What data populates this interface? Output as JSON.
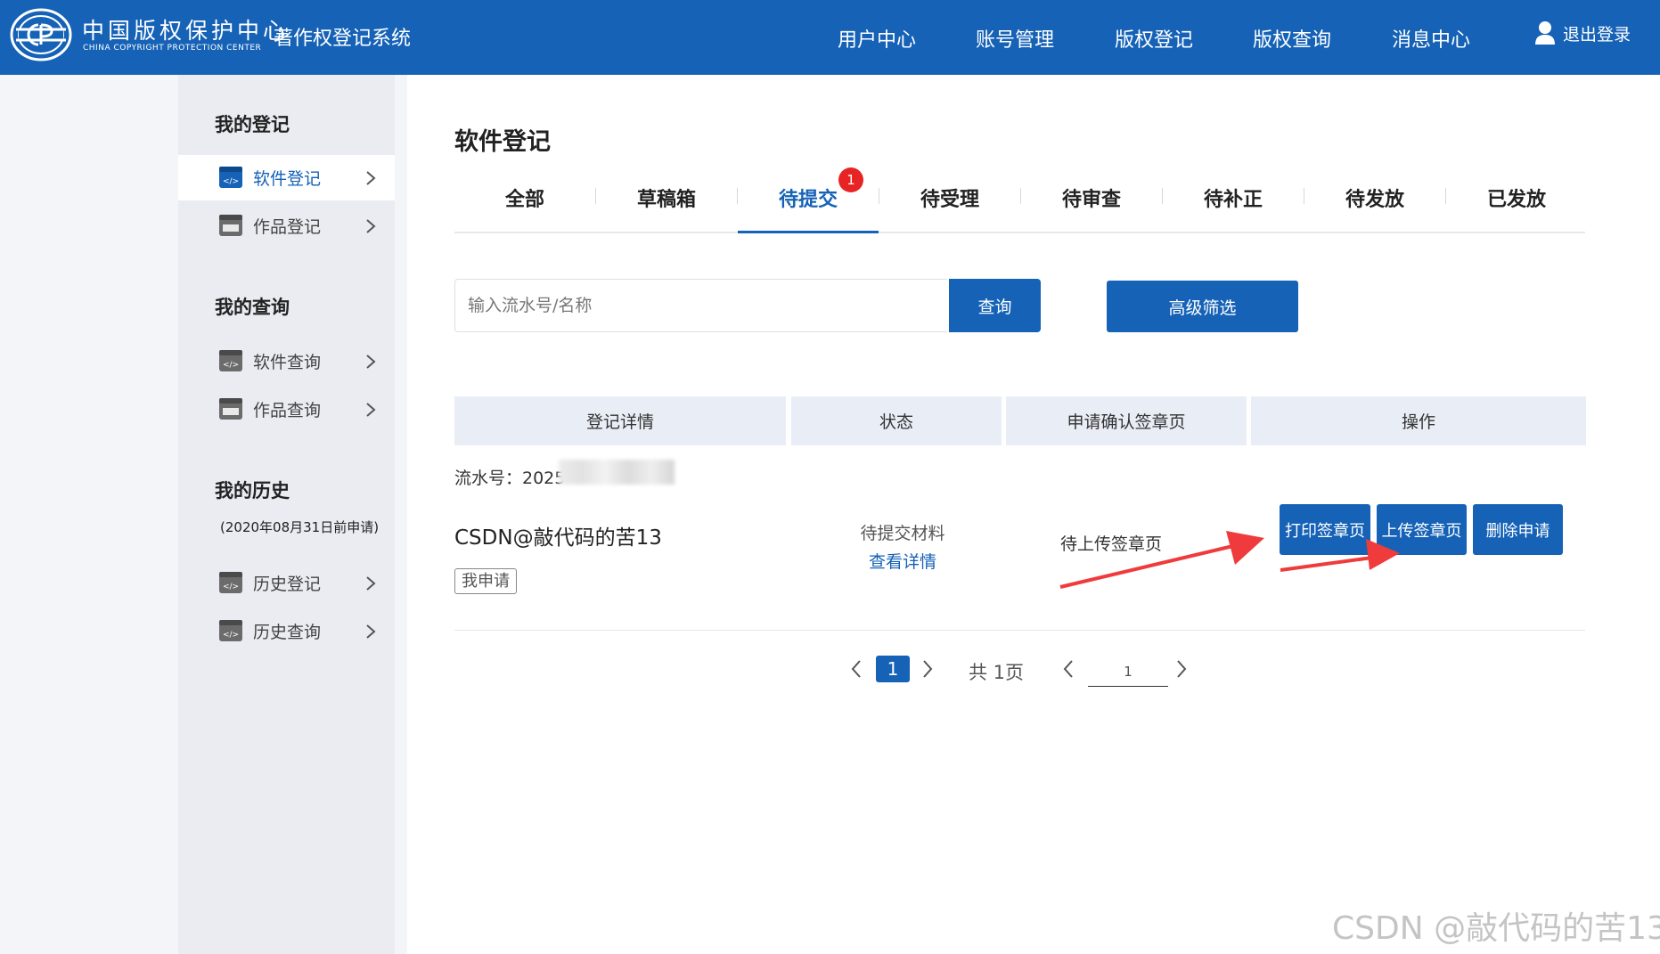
{
  "header": {
    "logo_cn": "中国版权保护中心",
    "logo_en": "CHINA COPYRIGHT PROTECTION CENTER",
    "system_title": "著作权登记系统",
    "nav": [
      "用户中心",
      "账号管理",
      "版权登记",
      "版权查询",
      "消息中心"
    ],
    "logout": "退出登录"
  },
  "sidebar": {
    "sections": [
      {
        "title": "我的登记",
        "items": [
          {
            "label": "软件登记",
            "active": true
          },
          {
            "label": "作品登记"
          }
        ]
      },
      {
        "title": "我的查询",
        "items": [
          {
            "label": "软件查询"
          },
          {
            "label": "作品查询"
          }
        ]
      },
      {
        "title": "我的历史",
        "subtitle": "(2020年08月31日前申请)",
        "items": [
          {
            "label": "历史登记"
          },
          {
            "label": "历史查询"
          }
        ]
      }
    ]
  },
  "main": {
    "title": "软件登记",
    "tabs": [
      "全部",
      "草稿箱",
      "待提交",
      "待受理",
      "待审查",
      "待补正",
      "待发放",
      "已发放"
    ],
    "active_tab": "待提交",
    "badge": "1",
    "search": {
      "placeholder": "输入流水号/名称",
      "button": "查询"
    },
    "advanced_button": "高级筛选",
    "table": {
      "headers": [
        "登记详情",
        "状态",
        "申请确认签章页",
        "操作"
      ],
      "rows": [
        {
          "serial_label": "流水号：2025",
          "name": "CSDN@敲代码的苦13",
          "tag": "我申请",
          "status": "待提交材料",
          "detail_link": "查看详情",
          "sign_status": "待上传签章页",
          "actions": [
            "打印签章页",
            "上传签章页",
            "删除申请"
          ]
        }
      ]
    },
    "pagination": {
      "current": "1",
      "total": "共 1页",
      "jump_value": "1"
    }
  },
  "watermark": "CSDN @敲代码的苦13",
  "colors": {
    "primary": "#1562b6",
    "badge": "#e82323",
    "annotation_arrow": "#ef3b3b"
  }
}
